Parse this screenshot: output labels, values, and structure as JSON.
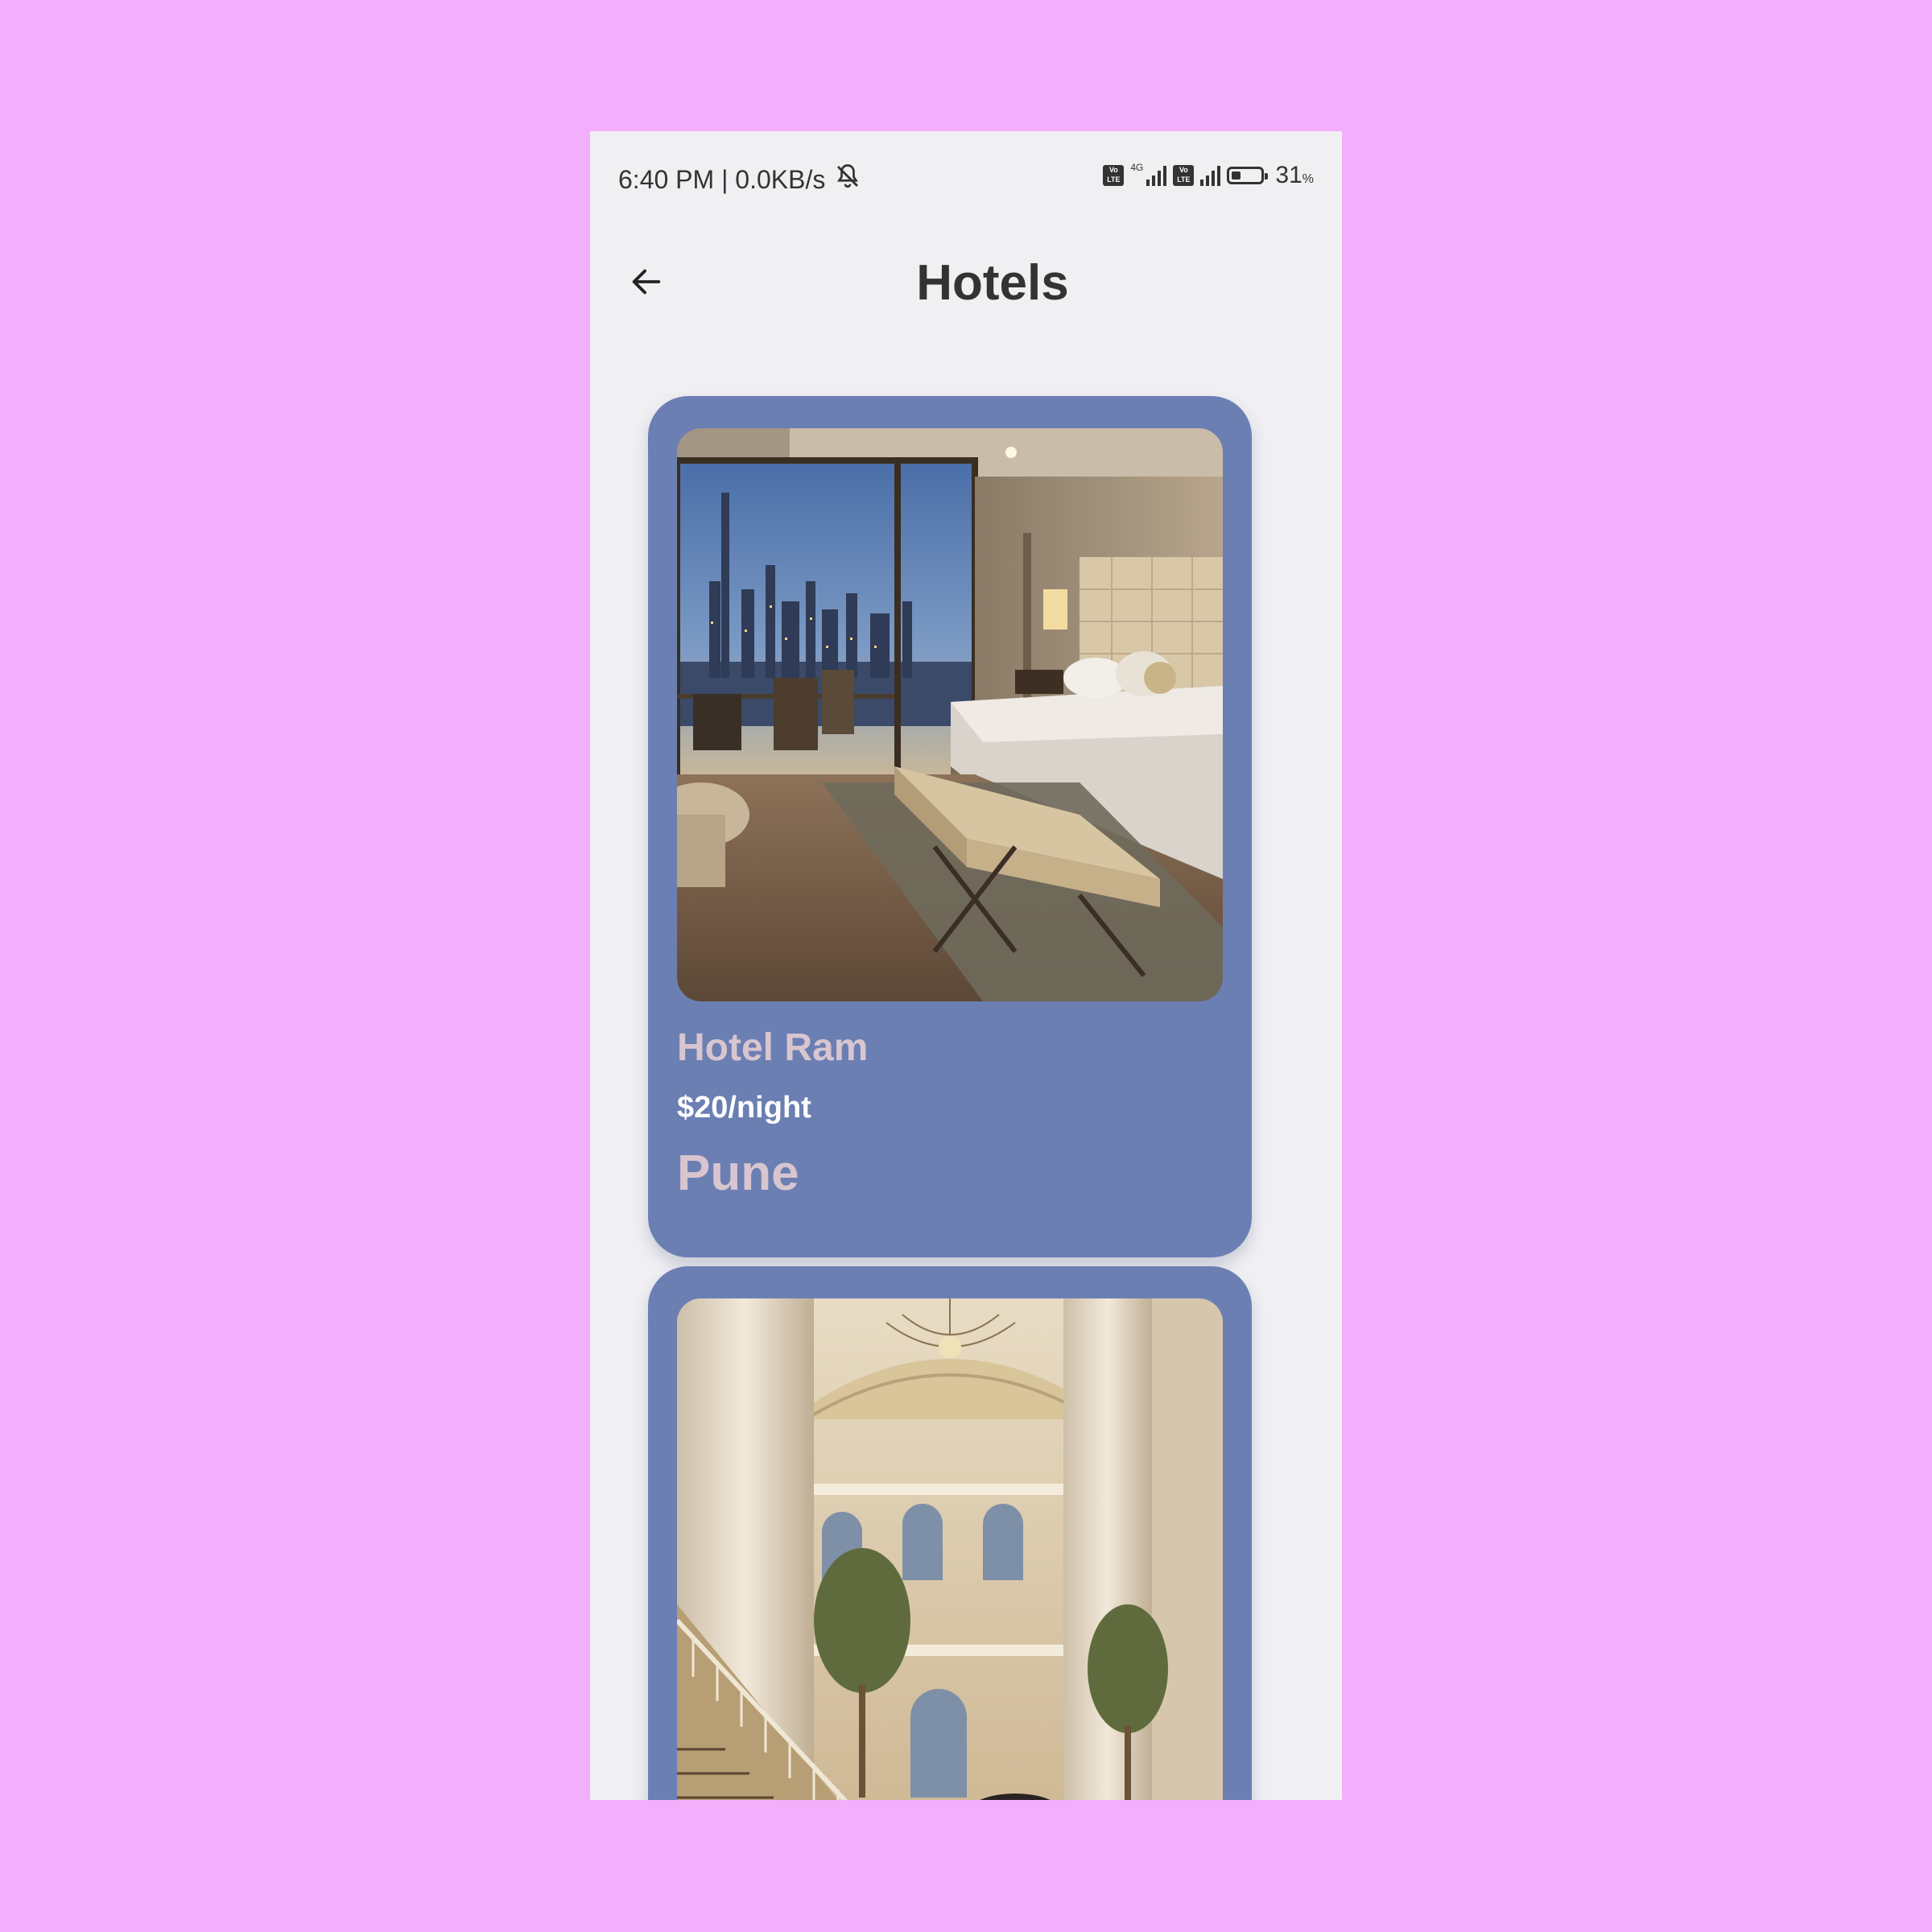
{
  "status_bar": {
    "time_speed": "6:40 PM | 0.0KB/s",
    "network_type": "4G",
    "battery_percent": "31",
    "battery_percent_sign": "%",
    "battery_level": 0.31
  },
  "app_bar": {
    "title": "Hotels"
  },
  "hotels": [
    {
      "name": "Hotel Ram",
      "price": "$20/night",
      "city": "Pune",
      "image": "hotel-room-bedroom-with-city-view"
    },
    {
      "image": "hotel-lobby-grand-staircase"
    }
  ],
  "colors": {
    "background": "#f3aefc",
    "screen": "#f0f0f3",
    "card": "#6b7fb3",
    "card_title_text": "#d8c5cf",
    "price_text": "#ffffff",
    "title_text": "#333333"
  }
}
